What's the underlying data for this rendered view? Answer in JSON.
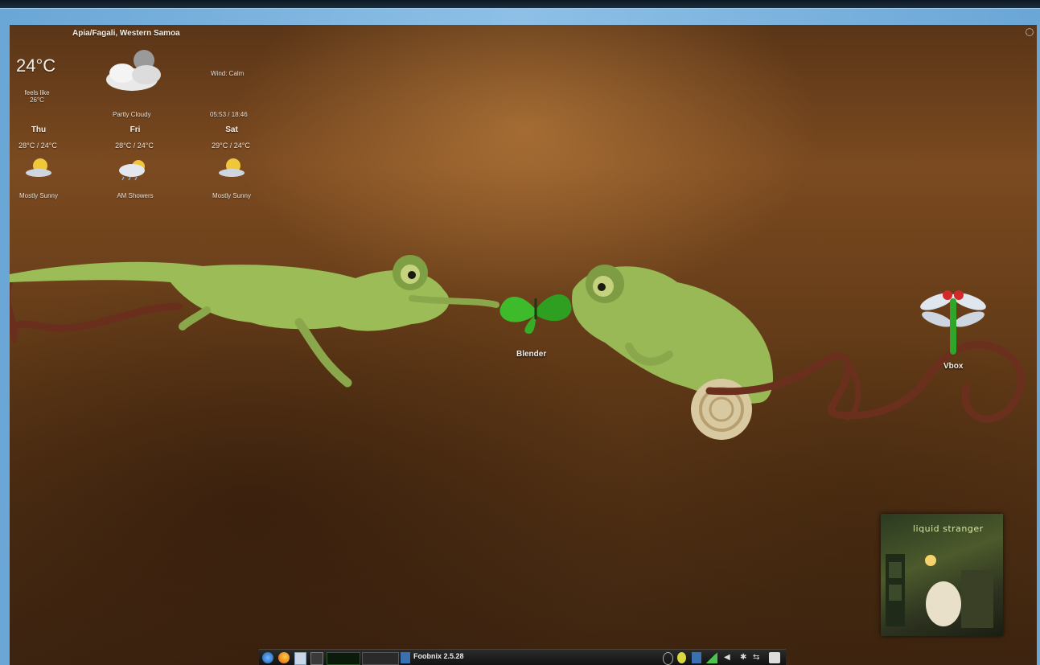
{
  "weather": {
    "location": "Apia/Fagali, Western Samoa",
    "current_temp": "24°C",
    "feels_like_label": "feels like",
    "feels_like_temp": "26°C",
    "wind": "Wind: Calm",
    "condition": "Partly Cloudy",
    "sunrise_sunset": "05:53 / 18:46",
    "forecast": [
      {
        "day": "Thu",
        "range": "28°C / 24°C",
        "condition": "Mostly Sunny",
        "icon": "sun-cloud-icon"
      },
      {
        "day": "Fri",
        "range": "28°C / 24°C",
        "condition": "AM Showers",
        "icon": "rain-cloud-icon"
      },
      {
        "day": "Sat",
        "range": "29°C / 24°C",
        "condition": "Mostly Sunny",
        "icon": "sun-cloud-icon"
      }
    ]
  },
  "desktop_icons": [
    {
      "label": "Blender",
      "icon": "butterfly-icon"
    },
    {
      "label": "Vbox",
      "icon": "dragonfly-icon"
    }
  ],
  "album_art": {
    "title": "liquid stranger"
  },
  "taskbar": {
    "launchers": [
      "menu-icon",
      "firefox-icon",
      "file-manager-icon",
      "terminal-icon"
    ],
    "active_window": "Foobnix 2.5.28",
    "tray": [
      "power-icon",
      "network-icon",
      "media-icon",
      "signal-icon",
      "volume-icon",
      "bluetooth-icon",
      "usb-icon",
      "battery-icon"
    ]
  },
  "colors": {
    "frame": "#79b0dc",
    "wallpaper": "#6a4018",
    "taskbar": "#1a1a1a"
  }
}
